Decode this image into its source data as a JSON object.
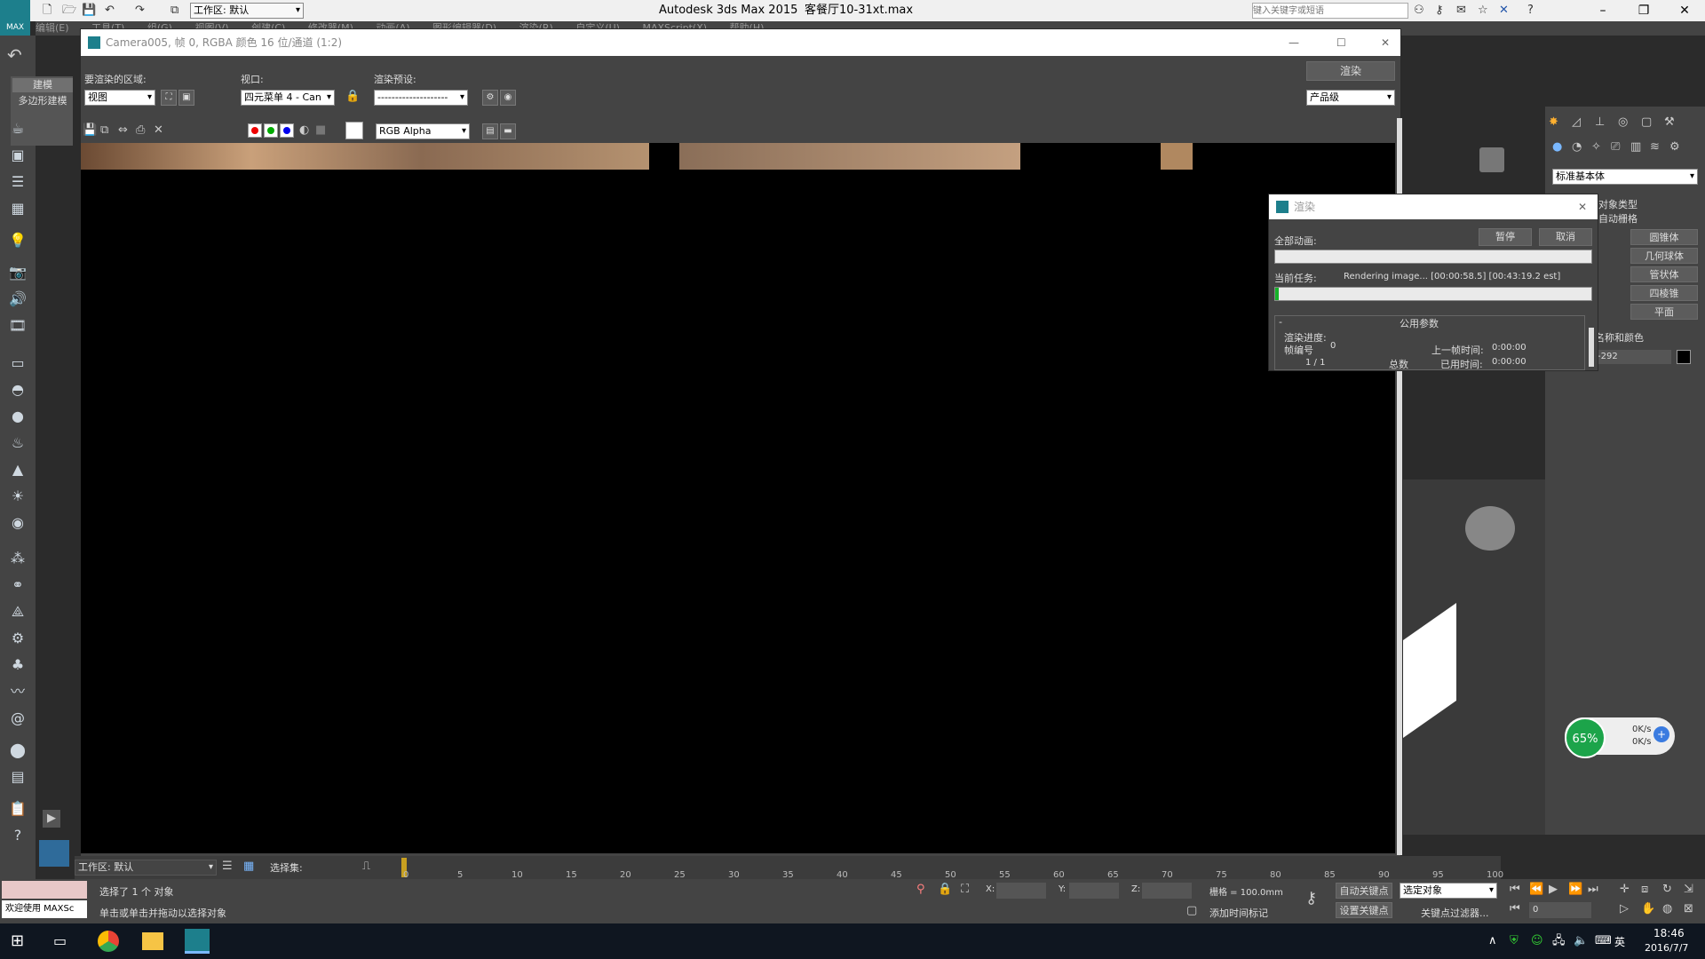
{
  "app": {
    "title": "Autodesk 3ds Max  2015",
    "file": "客餐厅10-31xt.max",
    "workspace_label": "工作区: 默认",
    "search_placeholder": "键入关键字或短语",
    "logo": "MAX"
  },
  "menu": [
    "编辑(E)",
    "工具(T)",
    "组(G)",
    "视图(V)",
    "创建(C)",
    "修改器(M)",
    "动画(A)",
    "图形编辑器(D)",
    "渲染(R)",
    "自定义(U)",
    "MAXScript(X)",
    "帮助(H)"
  ],
  "left_tabs": {
    "build": "建模",
    "poly": "多边形建模"
  },
  "render_window": {
    "title": "Camera005, 帧 0, RGBA 颜色 16 位/通道 (1:2)",
    "area_label": "要渲染的区域:",
    "area_value": "视图",
    "viewport_label": "视口:",
    "viewport_value": "四元菜单 4 - Can",
    "preset_label": "渲染预设:",
    "preset_value": "--------------------",
    "render_button": "渲染",
    "quality_value": "产品级",
    "channel_value": "RGB Alpha"
  },
  "progress_dialog": {
    "title": "渲染",
    "all_anim_label": "全部动画:",
    "pause_button": "暂停",
    "cancel_button": "取消",
    "current_task_label": "当前任务:",
    "current_task_text": "Rendering image... [00:00:58.5] [00:43:19.2 est]",
    "current_progress": 0.01,
    "section_header": "公用参数",
    "collapse": "-",
    "render_progress_label": "渲染进度:",
    "frame_no_label": "帧编号",
    "frame_no_value": "0",
    "frame_count": "1  /  1",
    "total_label": "总数",
    "last_frame_label": "上一帧时间:",
    "last_frame_value": "0:00:00",
    "elapsed_label": "已用时间:",
    "elapsed_value": "0:00:00"
  },
  "command_panel": {
    "category_value": "标准基本体",
    "object_type_header": "对象类型",
    "auto_grid": "自动栅格",
    "buttons": [
      "圆锥体",
      "几何球体",
      "管状体",
      "四棱锥",
      "平面"
    ],
    "name_color_header": "名称和颜色",
    "name_value": "-292"
  },
  "timeline": {
    "ticks": [
      "0",
      "5",
      "10",
      "15",
      "20",
      "25",
      "30",
      "35",
      "40",
      "45",
      "50",
      "55",
      "60",
      "65",
      "70",
      "75",
      "80",
      "85",
      "90",
      "95",
      "100"
    ]
  },
  "status": {
    "workspace": "工作区: 默认",
    "selection_set": "选择集:",
    "selected_text": "选择了 1 个 对象",
    "hint_text": "单击或单击并拖动以选择对象",
    "welcome": "欢迎使用 MAXSc",
    "x_label": "X:",
    "y_label": "Y:",
    "z_label": "Z:",
    "grid": "栅格 = 100.0mm",
    "auto_key": "自动关键点",
    "selected_object": "选定对象",
    "set_key": "设置关键点",
    "key_filter": "关键点过滤器...",
    "add_time_tag": "添加时间标记",
    "frame_value": "0"
  },
  "net_widget": {
    "percent": "65%",
    "up": "0K/s",
    "down": "0K/s"
  },
  "taskbar": {
    "time": "18:46",
    "date": "2016/7/7",
    "ime": "英"
  }
}
